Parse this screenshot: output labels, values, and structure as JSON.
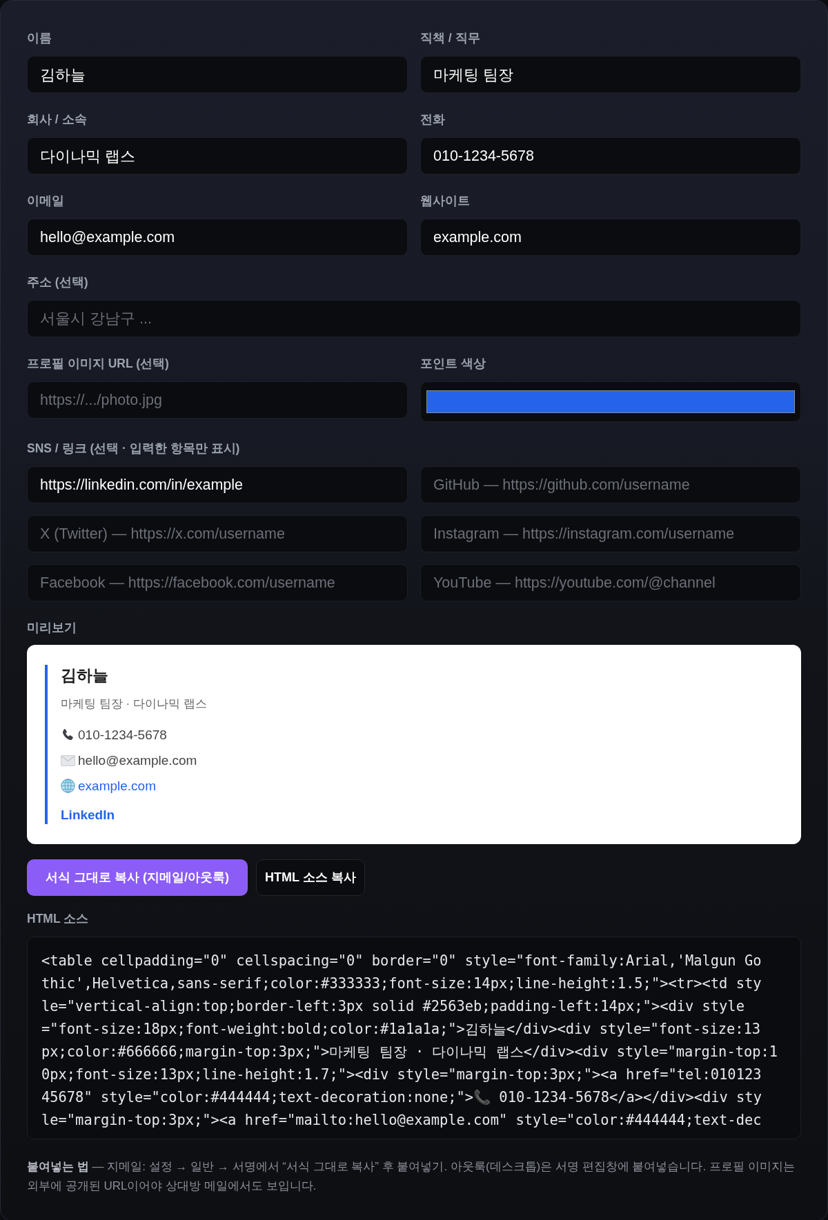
{
  "form": {
    "fields": [
      {
        "kind": "text",
        "label": "이름",
        "value": "김하늘"
      },
      {
        "kind": "text",
        "label": "직책 / 직무",
        "value": "마케팅 팀장"
      },
      {
        "kind": "text",
        "label": "회사 / 소속",
        "value": "다이나믹 랩스"
      },
      {
        "kind": "text",
        "label": "전화",
        "value": "010-1234-5678"
      },
      {
        "kind": "text",
        "label": "이메일",
        "value": "hello@example.com"
      },
      {
        "kind": "text",
        "label": "웹사이트",
        "value": "example.com"
      },
      {
        "kind": "wide",
        "label": "주소 (선택)",
        "placeholder": "서울시 강남구 ..."
      },
      {
        "kind": "text",
        "label": "프로필 이미지 URL (선택)",
        "placeholder": "https://.../photo.jpg"
      },
      {
        "kind": "color",
        "label": "포인트 색상",
        "color": "#2563eb"
      }
    ]
  },
  "sns": {
    "label": "SNS / 링크 (선택 · 입력한 항목만 표시)",
    "fields": [
      {
        "value": "https://linkedin.com/in/example"
      },
      {
        "placeholder": "GitHub — https://github.com/username"
      },
      {
        "placeholder": "X (Twitter) — https://x.com/username"
      },
      {
        "placeholder": "Instagram — https://instagram.com/username"
      },
      {
        "placeholder": "Facebook — https://facebook.com/username"
      },
      {
        "placeholder": "YouTube — https://youtube.com/@channel"
      }
    ]
  },
  "preview": {
    "label": "미리보기",
    "name": "김하늘",
    "subtitle": "마케팅 팀장 · 다이나믹 랩스",
    "contacts": [
      {
        "kind": "phone",
        "text": "010-1234-5678"
      },
      {
        "kind": "email",
        "text": "hello@example.com"
      },
      {
        "kind": "website",
        "text": "example.com"
      }
    ],
    "links": [
      "LinkedIn"
    ]
  },
  "actions": [
    {
      "kind": "primary",
      "label": "서식 그대로 복사 (지메일/아웃룩)"
    },
    {
      "kind": "secondary",
      "label": "HTML 소스 복사"
    }
  ],
  "html_source": {
    "label": "HTML 소스",
    "lines": [
      "<table cellpadding=\"0\" cellspacing=\"0\" border=\"0\" style=\"font-family:Arial,'Malgun Go",
      "thic',Helvetica,sans-serif;color:#333333;font-size:14px;line-height:1.5;\"><tr><td sty",
      "le=\"vertical-align:top;border-left:3px solid #2563eb;padding-left:14px;\"><div style",
      "=\"font-size:18px;font-weight:bold;color:#1a1a1a;\">김하늘</div><div style=\"font-size:13",
      "px;color:#666666;margin-top:3px;\">마케팅 팀장 · 다이나믹 랩스</div><div style=\"margin-top:1",
      "0px;font-size:13px;line-height:1.7;\"><div style=\"margin-top:3px;\"><a href=\"tel:010123",
      "45678\" style=\"color:#444444;text-decoration:none;\">📞 010-1234-5678</a></div><div sty",
      "le=\"margin-top:3px;\"><a href=\"mailto:hello@example.com\" style=\"color:#444444;text-dec"
    ]
  },
  "note": "**붙여넣는 법** — 지메일: 설정 → 일반 → 서명에서 “서식 그대로 복사” 후 붙여넣기. 아웃룩(데스크톱)은 서명 편집창에 붙여넣습니다. 프로필 이미지는 외부에 공개된 URL이어야 상대방 메일에서도 보입니다."
}
